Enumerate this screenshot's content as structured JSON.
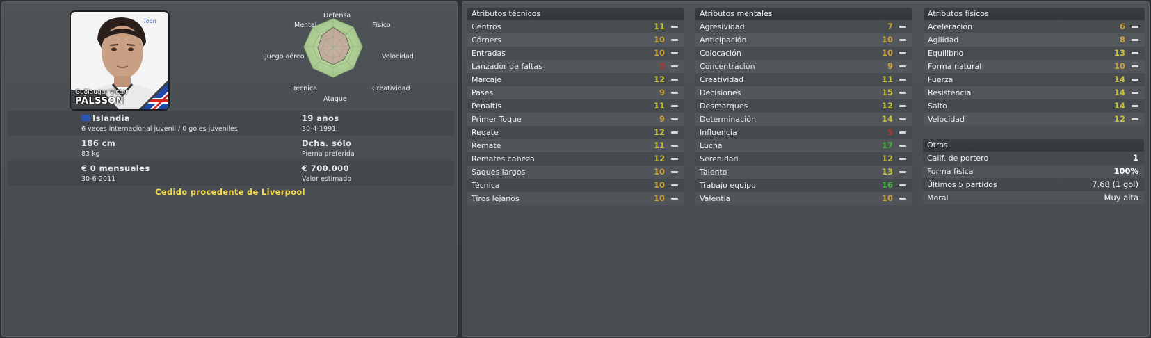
{
  "player": {
    "first_name": "Guðlaugur Victor",
    "last_name": "PÁLSSON",
    "nationality": "Islandia",
    "caps_text": "6 veces internacional juvenil / 0 goles juveniles",
    "age": "19 años",
    "birth_date": "30-4-1991",
    "height": "186 cm",
    "weight": "83 kg",
    "foot": "Dcha. sólo",
    "foot_label": "Pierna preferida",
    "wage": "€ 0 mensuales",
    "contract_end": "30-6-2011",
    "value": "€ 700.000",
    "value_label": "Valor estimado",
    "loan_text": "Cedido procedente de Liverpool"
  },
  "radar": {
    "labels": [
      "Defensa",
      "Físico",
      "Velocidad",
      "Creatividad",
      "Ataque",
      "Técnica",
      "Juego aéreo",
      "Mental"
    ],
    "fill_color": "#b7d6a0",
    "inner_color": "#c98f9a"
  },
  "columns": {
    "tecnicos": {
      "title": "Atributos técnicos",
      "rows": [
        {
          "name": "Centros",
          "value": "11",
          "color": "#c9c238"
        },
        {
          "name": "Córners",
          "value": "10",
          "color": "#c9a03a"
        },
        {
          "name": "Entradas",
          "value": "10",
          "color": "#c9a03a"
        },
        {
          "name": "Lanzador de faltas",
          "value": "5",
          "color": "#b8332d"
        },
        {
          "name": "Marcaje",
          "value": "12",
          "color": "#c9c238"
        },
        {
          "name": "Pases",
          "value": "9",
          "color": "#c9a03a"
        },
        {
          "name": "Penaltis",
          "value": "11",
          "color": "#c9c238"
        },
        {
          "name": "Primer Toque",
          "value": "9",
          "color": "#c9a03a"
        },
        {
          "name": "Regate",
          "value": "12",
          "color": "#c9c238"
        },
        {
          "name": "Remate",
          "value": "11",
          "color": "#c9c238"
        },
        {
          "name": "Remates cabeza",
          "value": "12",
          "color": "#c9c238"
        },
        {
          "name": "Saques largos",
          "value": "10",
          "color": "#c9a03a"
        },
        {
          "name": "Técnica",
          "value": "10",
          "color": "#c9a03a"
        },
        {
          "name": "Tiros lejanos",
          "value": "10",
          "color": "#c9a03a"
        }
      ]
    },
    "mentales": {
      "title": "Atributos mentales",
      "rows": [
        {
          "name": "Agresividad",
          "value": "7",
          "color": "#c9a03a"
        },
        {
          "name": "Anticipación",
          "value": "10",
          "color": "#c9a03a"
        },
        {
          "name": "Colocación",
          "value": "10",
          "color": "#c9a03a"
        },
        {
          "name": "Concentración",
          "value": "9",
          "color": "#c9a03a"
        },
        {
          "name": "Creatividad",
          "value": "11",
          "color": "#c9c238"
        },
        {
          "name": "Decisiones",
          "value": "15",
          "color": "#c9c238"
        },
        {
          "name": "Desmarques",
          "value": "12",
          "color": "#c9c238"
        },
        {
          "name": "Determinación",
          "value": "14",
          "color": "#c9c238"
        },
        {
          "name": "Influencia",
          "value": "5",
          "color": "#b8332d"
        },
        {
          "name": "Lucha",
          "value": "17",
          "color": "#3fb43a"
        },
        {
          "name": "Serenidad",
          "value": "12",
          "color": "#c9c238"
        },
        {
          "name": "Talento",
          "value": "13",
          "color": "#c9c238"
        },
        {
          "name": "Trabajo equipo",
          "value": "16",
          "color": "#3fb43a"
        },
        {
          "name": "Valentía",
          "value": "10",
          "color": "#c9a03a"
        }
      ]
    },
    "fisicos": {
      "title": "Atributos físicos",
      "rows": [
        {
          "name": "Aceleración",
          "value": "6",
          "color": "#c9a03a"
        },
        {
          "name": "Agilidad",
          "value": "8",
          "color": "#c9a03a"
        },
        {
          "name": "Equilibrio",
          "value": "13",
          "color": "#c9c238"
        },
        {
          "name": "Forma natural",
          "value": "10",
          "color": "#c9a03a"
        },
        {
          "name": "Fuerza",
          "value": "14",
          "color": "#c9c238"
        },
        {
          "name": "Resistencia",
          "value": "14",
          "color": "#c9c238"
        },
        {
          "name": "Salto",
          "value": "14",
          "color": "#c9c238"
        },
        {
          "name": "Velocidad",
          "value": "12",
          "color": "#c9c238"
        }
      ]
    }
  },
  "otros": {
    "title": "Otros",
    "rows": [
      {
        "name": "Calif. de portero",
        "value": "1"
      },
      {
        "name": "Forma física",
        "value": "100%"
      },
      {
        "name": "Últimos 5 partidos",
        "value": "7.68 (1 gol)"
      },
      {
        "name": "Moral",
        "value": "Muy alta"
      }
    ]
  }
}
